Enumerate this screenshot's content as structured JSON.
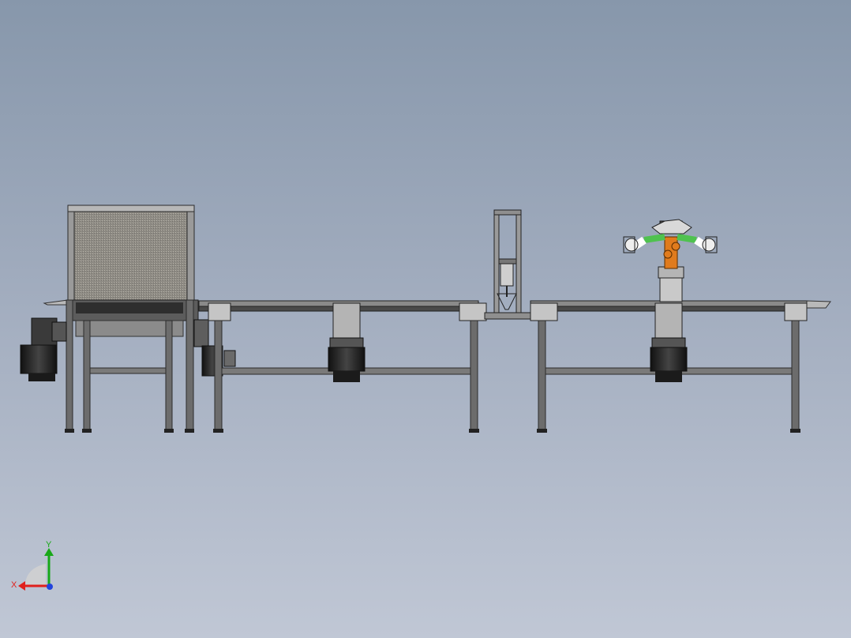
{
  "colors": {
    "frame": "#6e6e6e",
    "frame_dark": "#3c3c3c",
    "frame_light": "#a9a9a9",
    "motor": "#2a2a2a",
    "robot_orange": "#e07b1d",
    "robot_green": "#4fc24f",
    "axis_x": "#e0201c",
    "axis_y": "#18a818",
    "axis_z": "#2244dd"
  },
  "triad": {
    "x_label": "X",
    "y_label": "Y"
  }
}
